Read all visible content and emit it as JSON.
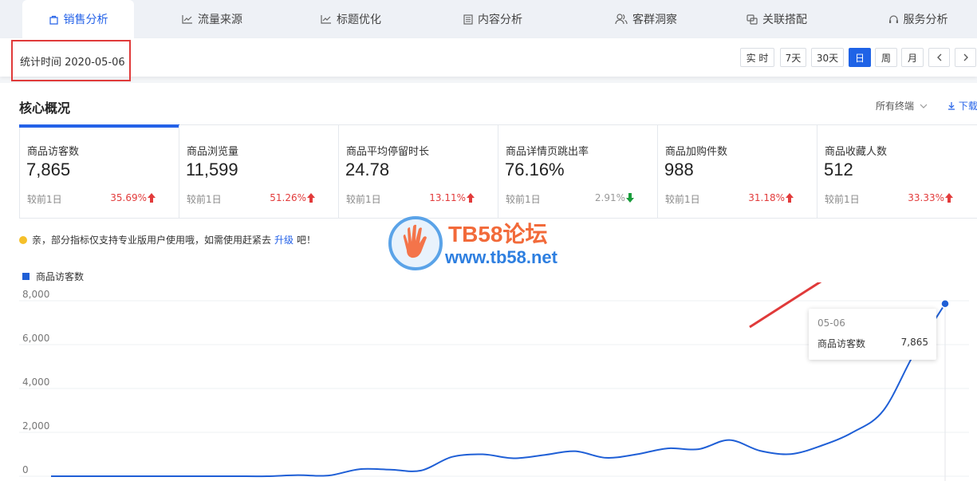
{
  "tabs": [
    {
      "label": "销售分析",
      "icon": "bag-icon",
      "active": true
    },
    {
      "label": "流量来源",
      "icon": "trend-icon",
      "active": false
    },
    {
      "label": "标题优化",
      "icon": "trend-icon",
      "active": false
    },
    {
      "label": "内容分析",
      "icon": "document-icon",
      "active": false
    },
    {
      "label": "客群洞察",
      "icon": "users-icon",
      "active": false
    },
    {
      "label": "关联搭配",
      "icon": "link-icon",
      "active": false
    },
    {
      "label": "服务分析",
      "icon": "headset-icon",
      "active": false
    }
  ],
  "toolbar": {
    "stat_time": "统计时间 2020-05-06",
    "ranges": [
      "实 时",
      "7天",
      "30天",
      "日",
      "周",
      "月"
    ],
    "active_range": "日"
  },
  "section": {
    "title": "核心概况",
    "terminal": "所有终端",
    "download": "下载"
  },
  "metrics": [
    {
      "label": "商品访客数",
      "value": "7,865",
      "compare": "较前1日",
      "change": "35.69%",
      "direction": "up"
    },
    {
      "label": "商品浏览量",
      "value": "11,599",
      "compare": "较前1日",
      "change": "51.26%",
      "direction": "up"
    },
    {
      "label": "商品平均停留时长",
      "value": "24.78",
      "compare": "较前1日",
      "change": "13.11%",
      "direction": "up"
    },
    {
      "label": "商品详情页跳出率",
      "value": "76.16%",
      "compare": "较前1日",
      "change": "2.91%",
      "direction": "down"
    },
    {
      "label": "商品加购件数",
      "value": "988",
      "compare": "较前1日",
      "change": "31.18%",
      "direction": "up"
    },
    {
      "label": "商品收藏人数",
      "value": "512",
      "compare": "较前1日",
      "change": "33.33%",
      "direction": "up"
    }
  ],
  "notice": {
    "before": "亲，部分指标仅支持专业版用户使用哦，如需使用赶紧去",
    "link": "升级",
    "after": "吧！"
  },
  "watermark": {
    "title": "TB58论坛",
    "url": "www.tb58.net"
  },
  "chart_data": {
    "type": "line",
    "series": [
      {
        "name": "商品访客数",
        "color": "#1f5fd6",
        "values": [
          0,
          0,
          0,
          0,
          0,
          0,
          0,
          0,
          50,
          30,
          320,
          300,
          260,
          880,
          1000,
          820,
          970,
          1140,
          840,
          1000,
          1270,
          1230,
          1650,
          1160,
          1010,
          1400,
          2000,
          3000,
          5600,
          7865
        ]
      }
    ],
    "ylim": [
      0,
      8000
    ],
    "yticks": [
      "0",
      "2,000",
      "4,000",
      "6,000",
      "8,000"
    ],
    "tooltip": {
      "date": "05-06",
      "name": "商品访客数",
      "value": "7,865"
    }
  },
  "colors": {
    "accent": "#2462e8",
    "up": "#e23b3b",
    "down": "#1a9c3c",
    "annotation": "#e03a3a"
  }
}
